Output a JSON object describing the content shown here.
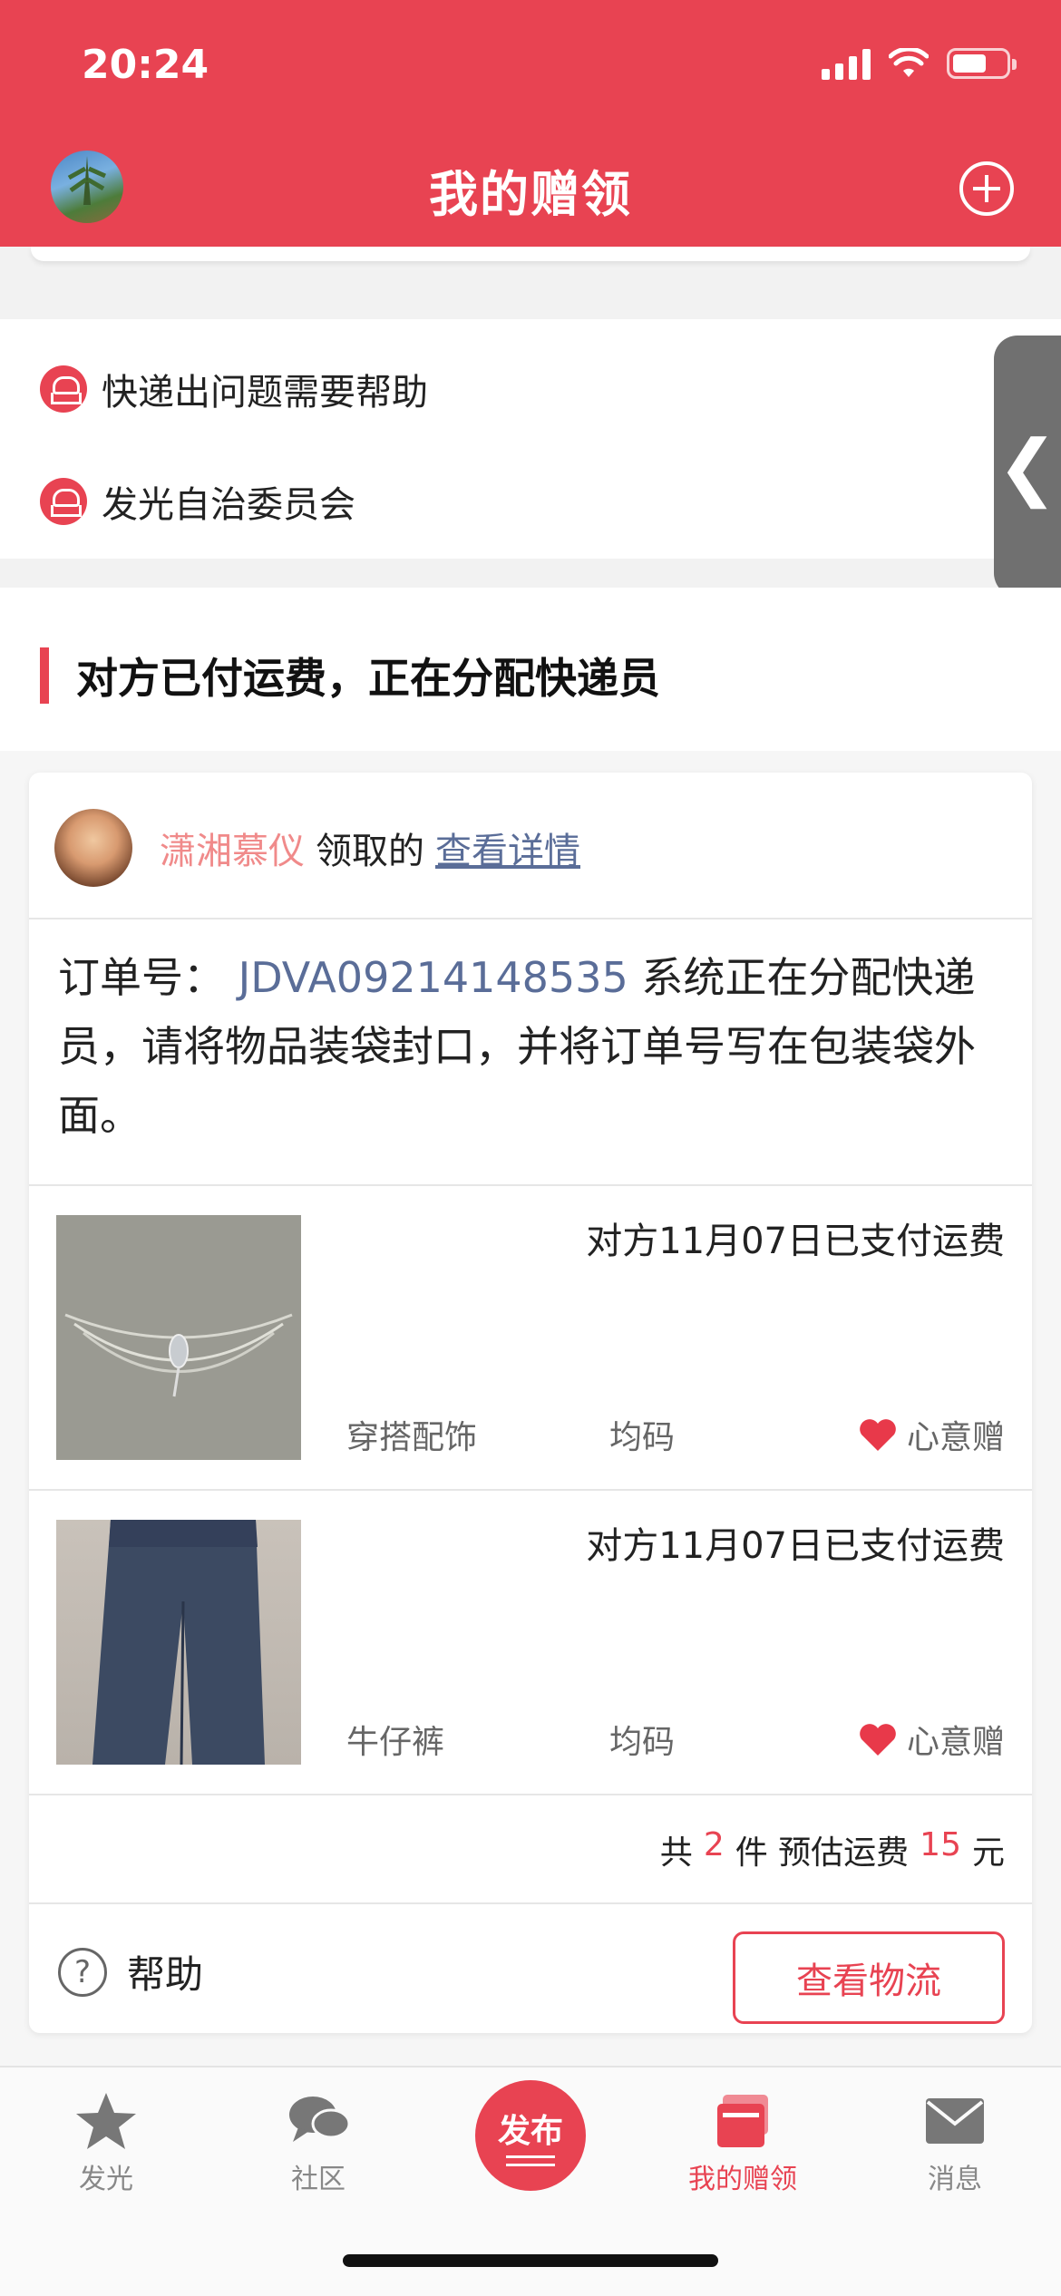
{
  "status_bar": {
    "time": "20:24"
  },
  "header": {
    "title": "我的赠领"
  },
  "links": [
    {
      "label": "快递出问题需要帮助"
    },
    {
      "label": "发光自治委员会"
    }
  ],
  "section": {
    "title": "对方已付运费，正在分配快递员"
  },
  "card": {
    "receiver": {
      "name": "潇湘慕仪",
      "action": "领取的",
      "detail_link": "查看详情"
    },
    "order": {
      "prefix": "订单号：",
      "order_id": "JDVA09214148535",
      "message": "系统正在分配快递员，请将物品装袋封口，并将订单号写在包装袋外面。"
    },
    "items": [
      {
        "paid_text": "对方11月07日已支付运费",
        "category": "穿搭配饰",
        "size": "均码",
        "gift_label": "心意赠"
      },
      {
        "paid_text": "对方11月07日已支付运费",
        "category": "牛仔裤",
        "size": "均码",
        "gift_label": "心意赠"
      }
    ],
    "summary": {
      "prefix": "共",
      "count": "2",
      "count_unit": "件 预估运费",
      "fee": "15",
      "fee_unit": "元"
    },
    "footer": {
      "help_label": "帮助",
      "logistics_button": "查看物流"
    }
  },
  "tabbar": {
    "tabs": [
      {
        "label": "发光",
        "icon": "star-icon"
      },
      {
        "label": "社区",
        "icon": "chat-bubbles-icon"
      },
      {
        "label": "发布",
        "icon": "publish-icon"
      },
      {
        "label": "我的赠领",
        "icon": "gift-box-icon",
        "active": true
      },
      {
        "label": "消息",
        "icon": "mail-icon"
      }
    ]
  },
  "colors": {
    "accent": "#e84352",
    "link": "#5a6d98",
    "username": "#f08a8a"
  }
}
